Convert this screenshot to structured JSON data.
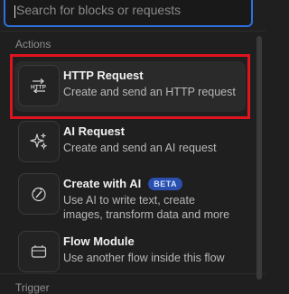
{
  "search": {
    "placeholder": "Search for blocks or requests",
    "value": ""
  },
  "sections": [
    {
      "title": "Actions",
      "items": [
        {
          "title": "HTTP Request",
          "description": "Create and send an HTTP request",
          "icon": "http-icon",
          "badge": ""
        },
        {
          "title": "AI Request",
          "description": "Create and send an AI request",
          "icon": "sparkles-icon",
          "badge": ""
        },
        {
          "title": "Create with AI",
          "description": "Use AI to write text, create images, transform data and more",
          "icon": "magic-wand-icon",
          "badge": "BETA"
        },
        {
          "title": "Flow Module",
          "description": "Use another flow inside this flow",
          "icon": "module-icon",
          "badge": ""
        }
      ]
    },
    {
      "title": "Trigger",
      "items": []
    }
  ],
  "colors": {
    "background": "#1f1f1f",
    "focus_border": "#2f6fe0",
    "highlight": "#e0141e",
    "badge": "#2a4fae"
  }
}
